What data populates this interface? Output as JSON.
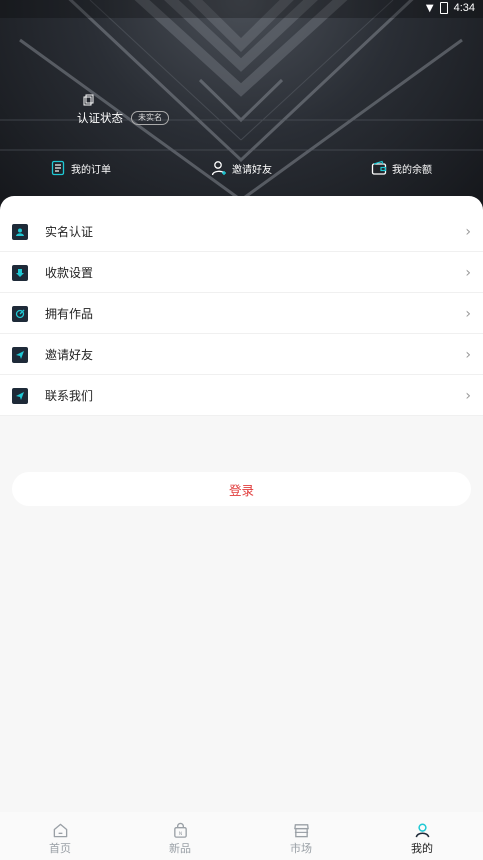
{
  "status_bar": {
    "time": "4:34"
  },
  "profile": {
    "auth_label": "认证状态",
    "auth_badge": "未实名"
  },
  "quick_actions": [
    {
      "label": "我的订单",
      "icon": "order-list-icon"
    },
    {
      "label": "邀请好友",
      "icon": "user-add-icon"
    },
    {
      "label": "我的余额",
      "icon": "wallet-icon"
    }
  ],
  "menu": [
    {
      "label": "实名认证",
      "icon": "id-card-icon"
    },
    {
      "label": "收款设置",
      "icon": "download-icon"
    },
    {
      "label": "拥有作品",
      "icon": "artwork-icon"
    },
    {
      "label": "邀请好友",
      "icon": "send-icon"
    },
    {
      "label": "联系我们",
      "icon": "send-icon"
    }
  ],
  "login_button": "登录",
  "tabs": [
    {
      "label": "首页",
      "icon": "home-icon",
      "active": false
    },
    {
      "label": "新品",
      "icon": "bag-icon",
      "active": false
    },
    {
      "label": "市场",
      "icon": "store-icon",
      "active": false
    },
    {
      "label": "我的",
      "icon": "user-icon",
      "active": true
    }
  ],
  "colors": {
    "accent": "#1fc8d4",
    "login_text": "#e03a3a",
    "icon_bg": "#1e2a38"
  }
}
